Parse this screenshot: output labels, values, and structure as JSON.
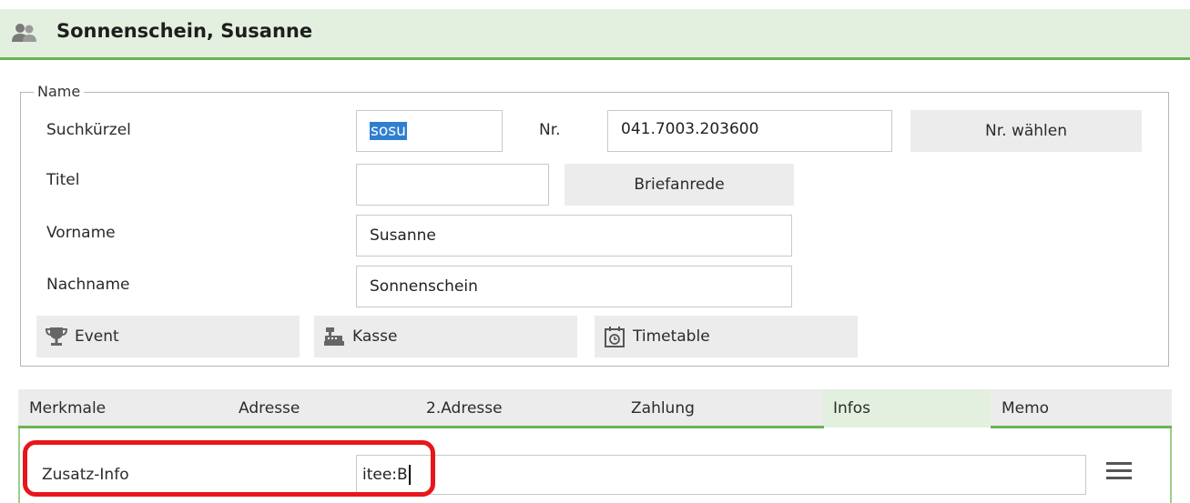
{
  "header": {
    "title": "Sonnenschein, Susanne",
    "icon": "user-group-icon",
    "accent": "#6db255",
    "background": "#e4f0df"
  },
  "name_group": {
    "legend": "Name",
    "suchkuerzel": {
      "label": "Suchkürzel",
      "value": "sosu"
    },
    "nr": {
      "label": "Nr.",
      "value": "041.7003.203600",
      "button": "Nr. wählen"
    },
    "titel": {
      "label": "Titel",
      "value": "",
      "button": "Briefanrede"
    },
    "vorname": {
      "label": "Vorname",
      "value": "Susanne"
    },
    "nachname": {
      "label": "Nachname",
      "value": "Sonnenschein"
    },
    "actions": [
      {
        "label": "Event",
        "icon": "trophy-icon"
      },
      {
        "label": "Kasse",
        "icon": "cash-register-icon"
      },
      {
        "label": "Timetable",
        "icon": "calendar-clock-icon"
      }
    ]
  },
  "tabs": [
    {
      "label": "Merkmale",
      "active": false
    },
    {
      "label": "Adresse",
      "active": false
    },
    {
      "label": "2.Adresse",
      "active": false
    },
    {
      "label": "Zahlung",
      "active": false
    },
    {
      "label": "Infos",
      "active": true
    },
    {
      "label": "Memo",
      "active": false
    }
  ],
  "infos": {
    "zusatz_label": "Zusatz-Info",
    "zusatz_value": "itee:B",
    "menu_icon": "hamburger-menu-icon",
    "highlight_color": "#e8161b"
  }
}
